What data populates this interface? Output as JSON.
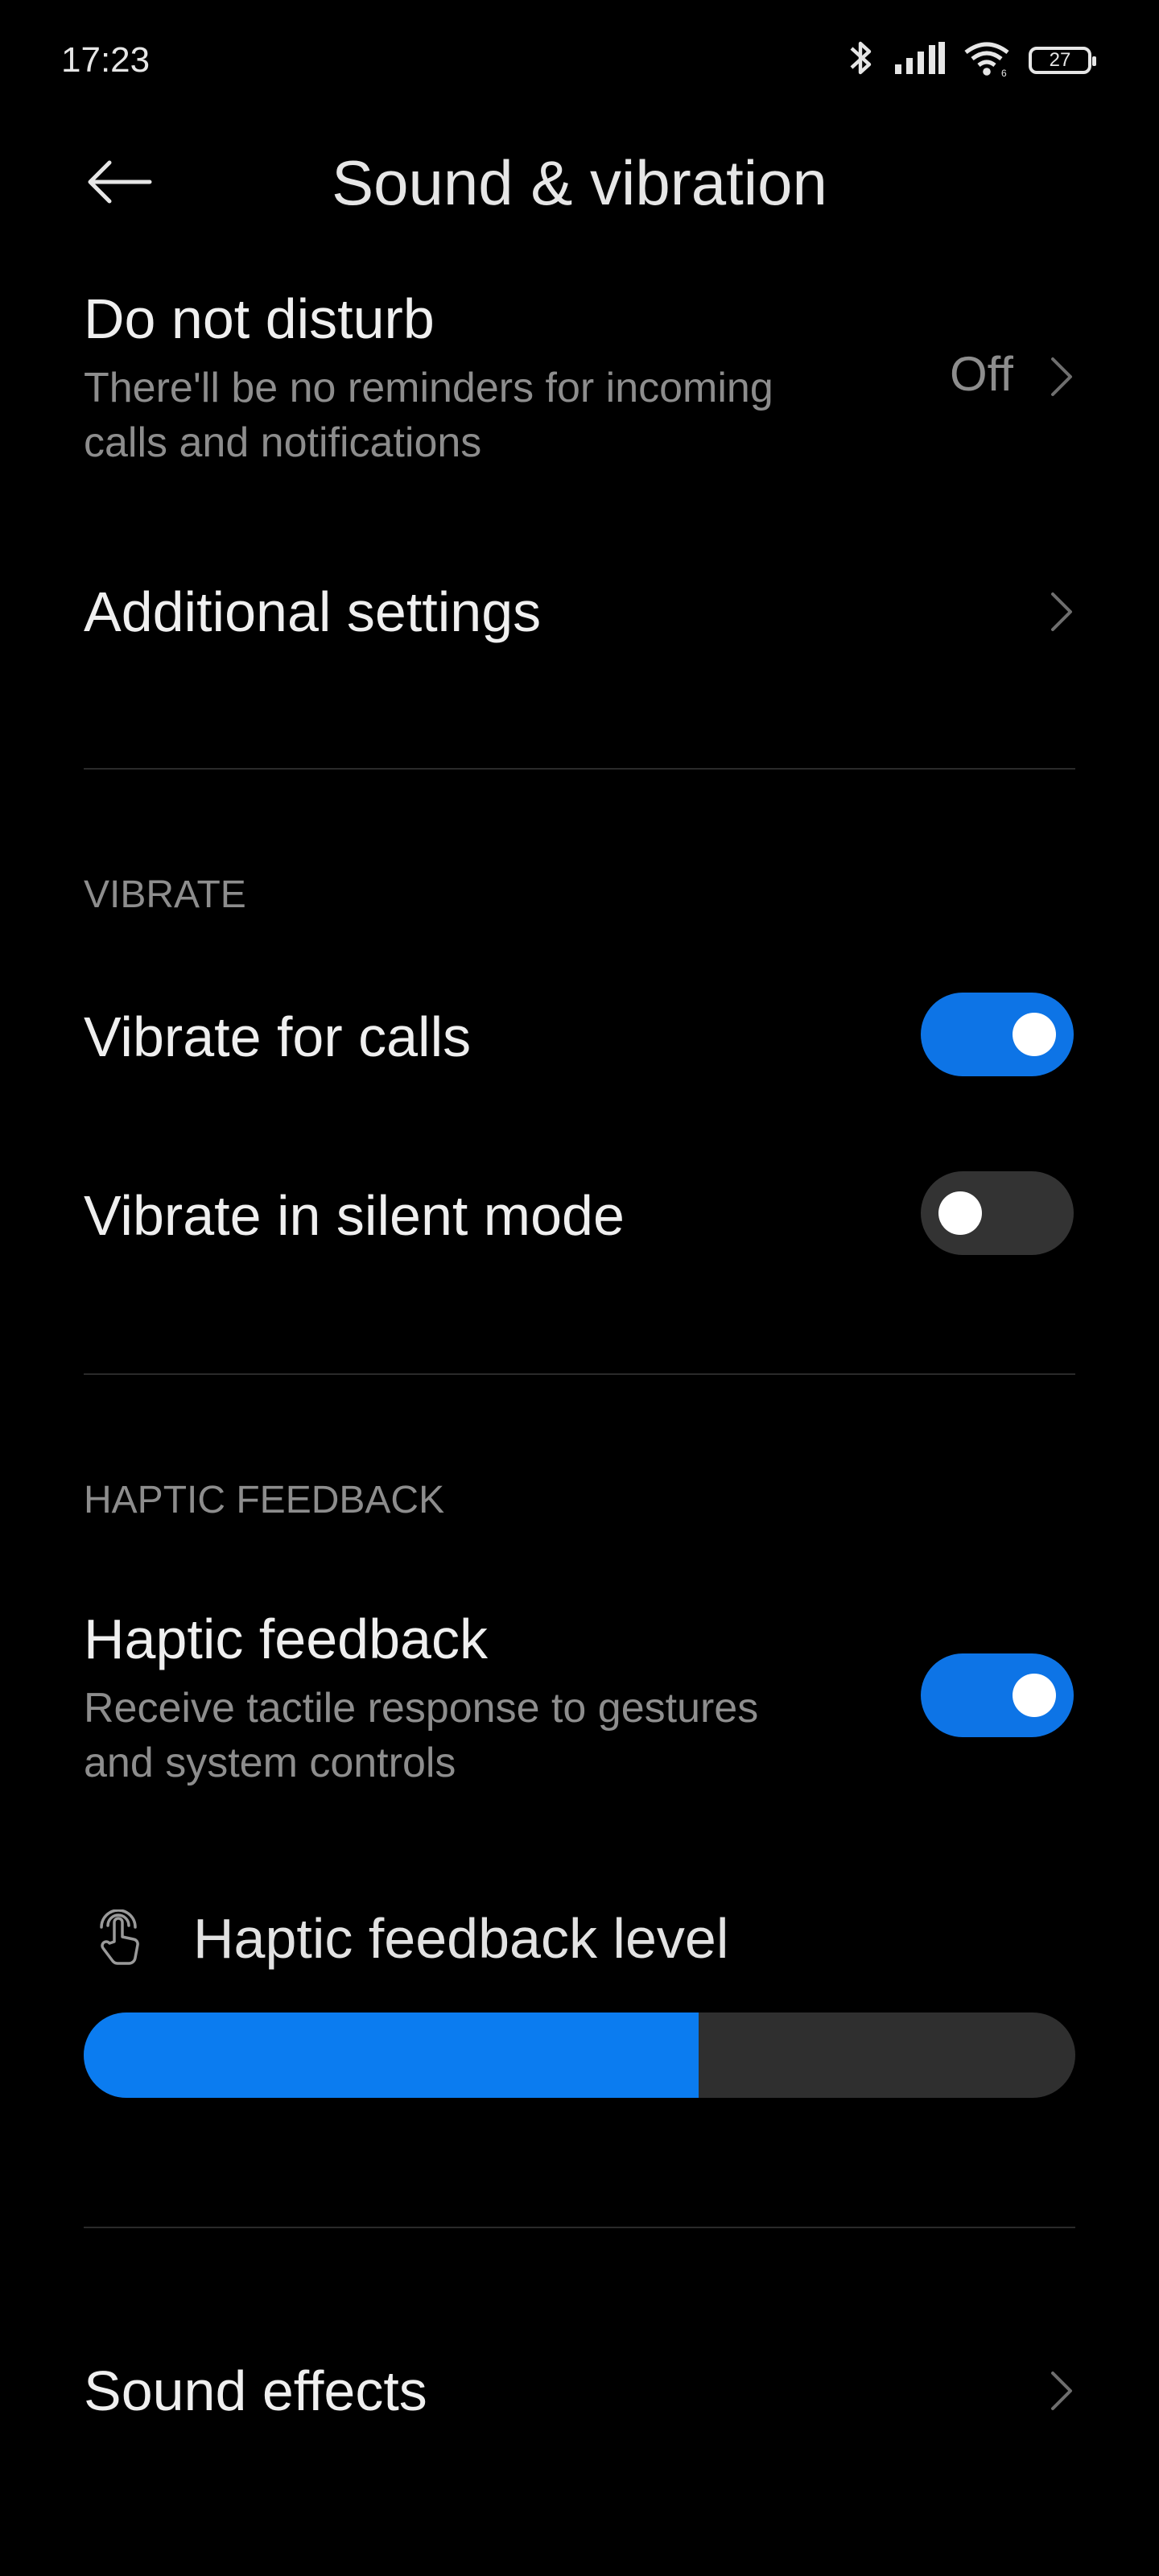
{
  "status_bar": {
    "time": "17:23",
    "battery_level": "27",
    "icons": [
      "bluetooth-icon",
      "cellular-signal-icon",
      "wifi-icon",
      "battery-icon"
    ]
  },
  "header": {
    "title": "Sound & vibration",
    "back_icon": "arrow-left-icon"
  },
  "do_not_disturb": {
    "title": "Do not disturb",
    "subtitle_line1": "There'll be no reminders for incoming",
    "subtitle_line2": "calls and notifications",
    "value": "Off"
  },
  "additional_settings": {
    "title": "Additional settings"
  },
  "vibrate_section": {
    "header": "VIBRATE",
    "items": [
      {
        "label": "Vibrate for calls",
        "enabled": true
      },
      {
        "label": "Vibrate in silent mode",
        "enabled": false
      }
    ]
  },
  "haptic_section": {
    "header": "HAPTIC FEEDBACK",
    "haptic_feedback": {
      "title": "Haptic feedback",
      "subtitle_line1": "Receive tactile response to gestures",
      "subtitle_line2": "and system controls",
      "enabled": true
    },
    "level": {
      "label": "Haptic feedback level",
      "icon": "touch-gesture-icon",
      "value_fraction": 0.62
    }
  },
  "sound_effects": {
    "title": "Sound effects"
  },
  "colors": {
    "background": "#000000",
    "accent": "#0d74e6",
    "slider_fill": "#0b7cf0",
    "toggle_off": "#333333",
    "secondary_text": "#8d8d8d"
  }
}
